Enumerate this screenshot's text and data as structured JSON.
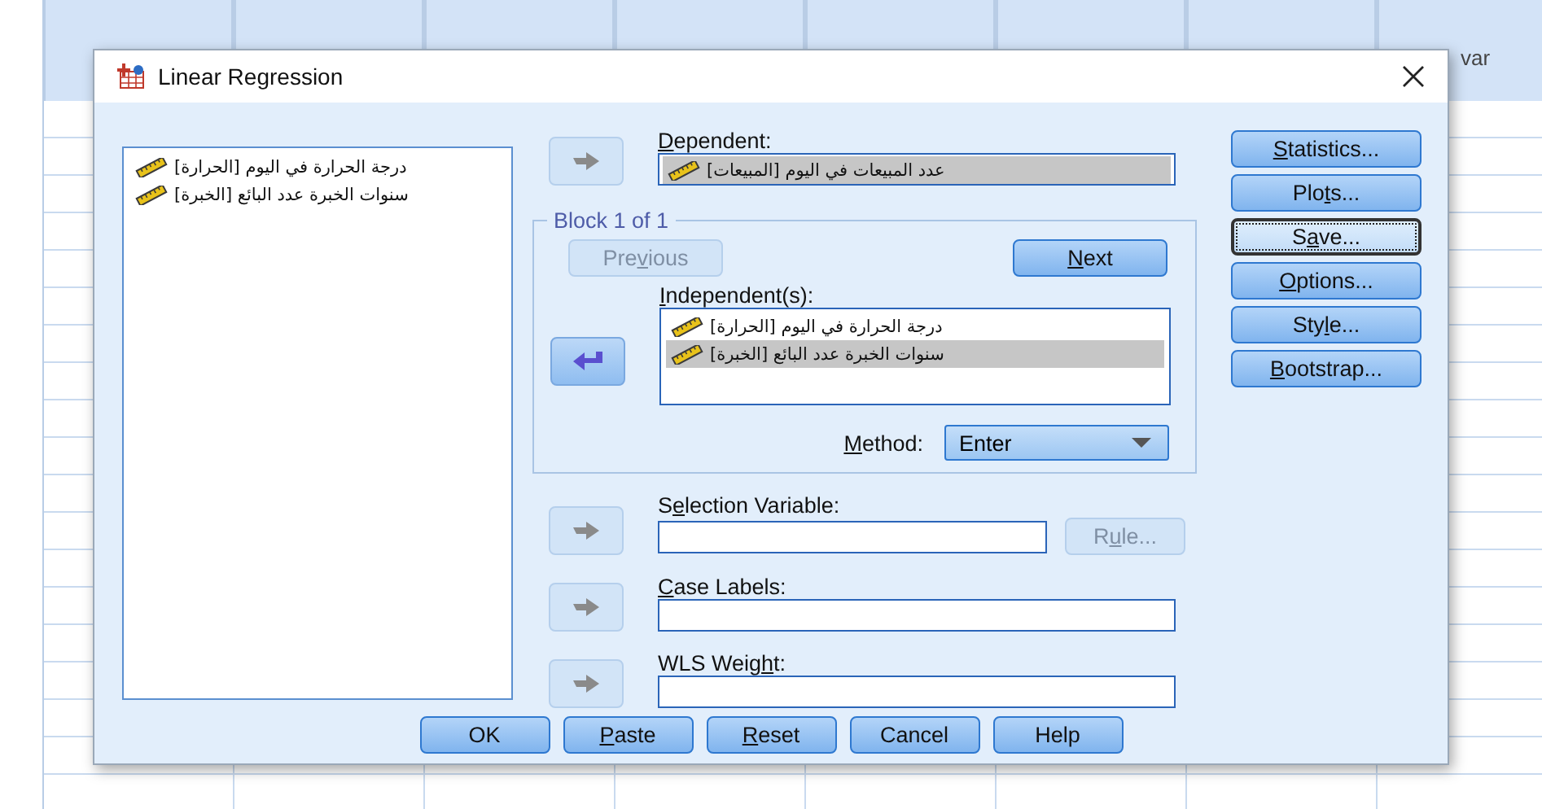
{
  "spreadsheet": {
    "column_header": "var"
  },
  "window": {
    "title": "Linear Regression"
  },
  "variables": [
    {
      "name": "درجة الحرارة في اليوم [الحرارة]",
      "selected": false
    },
    {
      "name": "سنوات الخبرة عدد البائع [الخبرة]",
      "selected": false
    }
  ],
  "dependent": {
    "label": [
      {
        "text": "D",
        "underline": true
      },
      {
        "text": "ependent:",
        "underline": false
      }
    ],
    "arrow": {
      "kind": "right-arrow",
      "disabled": true
    },
    "items": [
      {
        "name": "عدد المبيعات في اليوم [المبيعات]",
        "selected": true
      }
    ]
  },
  "block": {
    "title": "Block 1 of 1",
    "previous": {
      "label": [
        {
          "text": "Pre",
          "underline": false
        },
        {
          "text": "v",
          "underline": true
        },
        {
          "text": "ious",
          "underline": false
        }
      ],
      "disabled": true
    },
    "next": {
      "label": [
        {
          "text": "N",
          "underline": true
        },
        {
          "text": "ext",
          "underline": false
        }
      ],
      "disabled": false
    },
    "independent": {
      "label": [
        {
          "text": "I",
          "underline": true
        },
        {
          "text": "ndependent(s):",
          "underline": false
        }
      ],
      "arrow": {
        "kind": "left-arrow",
        "disabled": false
      },
      "items": [
        {
          "name": "درجة الحرارة في اليوم [الحرارة]",
          "selected": false
        },
        {
          "name": "سنوات الخبرة عدد البائع [الخبرة]",
          "selected": true
        }
      ]
    },
    "method": {
      "label": [
        {
          "text": "M",
          "underline": true
        },
        {
          "text": "ethod:",
          "underline": false
        }
      ],
      "value": "Enter"
    }
  },
  "selection_variable": {
    "label": [
      {
        "text": "S",
        "underline": false
      },
      {
        "text": "e",
        "underline": true
      },
      {
        "text": "lection Variable:",
        "underline": false
      }
    ],
    "arrow": {
      "kind": "right-arrow",
      "disabled": true
    },
    "rule": {
      "label": [
        {
          "text": "R",
          "underline": false
        },
        {
          "text": "u",
          "underline": true
        },
        {
          "text": "le...",
          "underline": false
        }
      ],
      "disabled": true
    }
  },
  "case_labels": {
    "label": [
      {
        "text": "C",
        "underline": true
      },
      {
        "text": "ase Labels:",
        "underline": false
      }
    ],
    "arrow": {
      "kind": "right-arrow",
      "disabled": true
    }
  },
  "wls_weight": {
    "label": [
      {
        "text": "WLS Weig",
        "underline": false
      },
      {
        "text": "h",
        "underline": true
      },
      {
        "text": "t:",
        "underline": false
      }
    ],
    "arrow": {
      "kind": "right-arrow",
      "disabled": true
    }
  },
  "side_buttons": [
    {
      "label": [
        {
          "text": "S",
          "underline": true
        },
        {
          "text": "tatistics...",
          "underline": false
        }
      ],
      "focused": false
    },
    {
      "label": [
        {
          "text": "Plo",
          "underline": false
        },
        {
          "text": "t",
          "underline": true
        },
        {
          "text": "s...",
          "underline": false
        }
      ],
      "focused": false
    },
    {
      "label": [
        {
          "text": "S",
          "underline": false
        },
        {
          "text": "a",
          "underline": true
        },
        {
          "text": "ve...",
          "underline": false
        }
      ],
      "focused": true
    },
    {
      "label": [
        {
          "text": "O",
          "underline": true
        },
        {
          "text": "ptions...",
          "underline": false
        }
      ],
      "focused": false
    },
    {
      "label": [
        {
          "text": "Sty",
          "underline": false
        },
        {
          "text": "l",
          "underline": true
        },
        {
          "text": "e...",
          "underline": false
        }
      ],
      "focused": false
    },
    {
      "label": [
        {
          "text": "B",
          "underline": true
        },
        {
          "text": "ootstrap...",
          "underline": false
        }
      ],
      "focused": false
    }
  ],
  "buttons": [
    {
      "label": [
        {
          "text": "OK",
          "underline": false
        }
      ]
    },
    {
      "label": [
        {
          "text": "P",
          "underline": true
        },
        {
          "text": "aste",
          "underline": false
        }
      ]
    },
    {
      "label": [
        {
          "text": "R",
          "underline": true
        },
        {
          "text": "eset",
          "underline": false
        }
      ]
    },
    {
      "label": [
        {
          "text": "Cancel",
          "underline": false
        }
      ]
    },
    {
      "label": [
        {
          "text": "Help",
          "underline": false
        }
      ]
    }
  ]
}
